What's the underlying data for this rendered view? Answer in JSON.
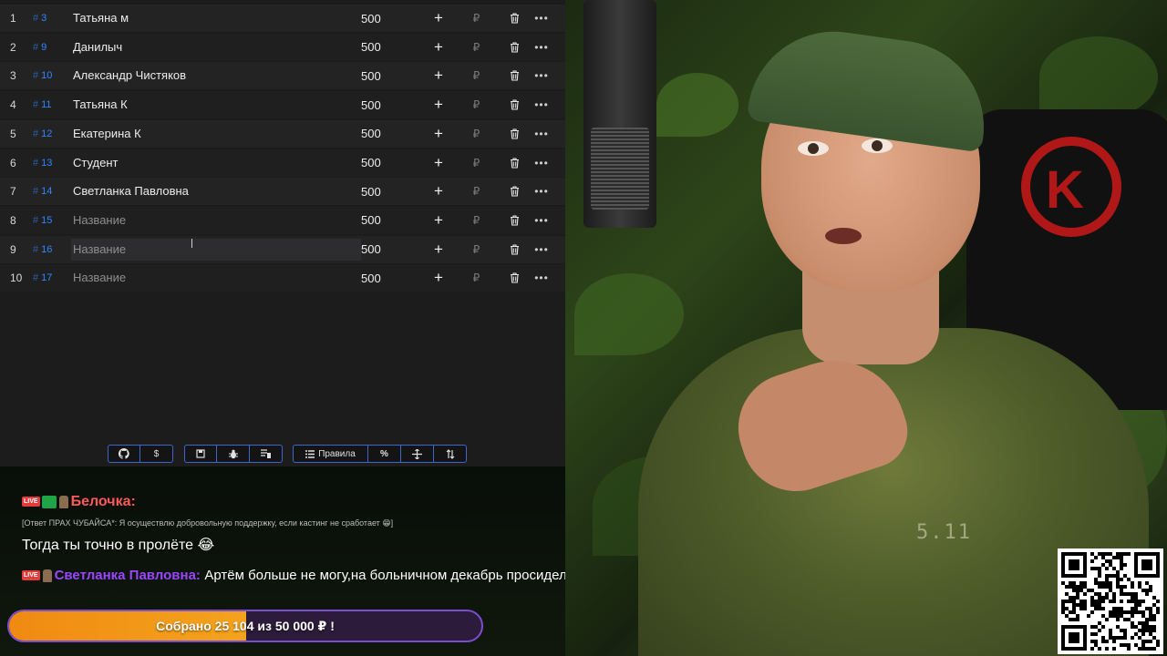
{
  "table": {
    "rows": [
      {
        "num": "1",
        "idx": "3",
        "name": "Татьяна м",
        "placeholder": false,
        "amount": "500"
      },
      {
        "num": "2",
        "idx": "9",
        "name": "Данилыч",
        "placeholder": false,
        "amount": "500"
      },
      {
        "num": "3",
        "idx": "10",
        "name": "Александр Чистяков",
        "placeholder": false,
        "amount": "500"
      },
      {
        "num": "4",
        "idx": "11",
        "name": "Татьяна К",
        "placeholder": false,
        "amount": "500"
      },
      {
        "num": "5",
        "idx": "12",
        "name": "Екатерина К",
        "placeholder": false,
        "amount": "500"
      },
      {
        "num": "6",
        "idx": "13",
        "name": "Студент",
        "placeholder": false,
        "amount": "500"
      },
      {
        "num": "7",
        "idx": "14",
        "name": "Светланка Павловна",
        "placeholder": false,
        "amount": "500"
      },
      {
        "num": "8",
        "idx": "15",
        "name": "Название",
        "placeholder": true,
        "amount": "500"
      },
      {
        "num": "9",
        "idx": "16",
        "name": "Название",
        "placeholder": true,
        "amount": "500"
      },
      {
        "num": "10",
        "idx": "17",
        "name": "Название",
        "placeholder": true,
        "amount": "500"
      }
    ],
    "hash_symbol": "#",
    "plus_symbol": "+",
    "currency_symbol": "₽",
    "more_symbol": "•••"
  },
  "toolbar": {
    "rules_label": "Правила",
    "dollar_label": "$",
    "percent_label": "%",
    "icons": [
      "github-icon",
      "dollar-icon",
      "save-icon",
      "bug-icon",
      "clear-list-icon",
      "list-icon",
      "percent-icon",
      "split-icon",
      "sort-icon"
    ]
  },
  "chat": {
    "messages": [
      {
        "user": "Белочка:",
        "user_color": "#ff5a5a",
        "reply": "[Ответ ПРАХ ЧУБАЙСА*: Я осуществлю добровольную поддержку, если кастинг не сработает 😁]",
        "text": "Тогда ты точно в пролёте 😂"
      },
      {
        "user": "Светланка Павловна:",
        "user_color": "#9b45ff",
        "text": "Артём больше не могу,на больничном декабрь просидела 🙈"
      }
    ],
    "live_badge": "LIVE"
  },
  "donation": {
    "text": "Собрано 25 104  из 50 000 ₽ !",
    "progress": 0.5021
  },
  "overlay": {
    "shirt_text": "5.11"
  }
}
